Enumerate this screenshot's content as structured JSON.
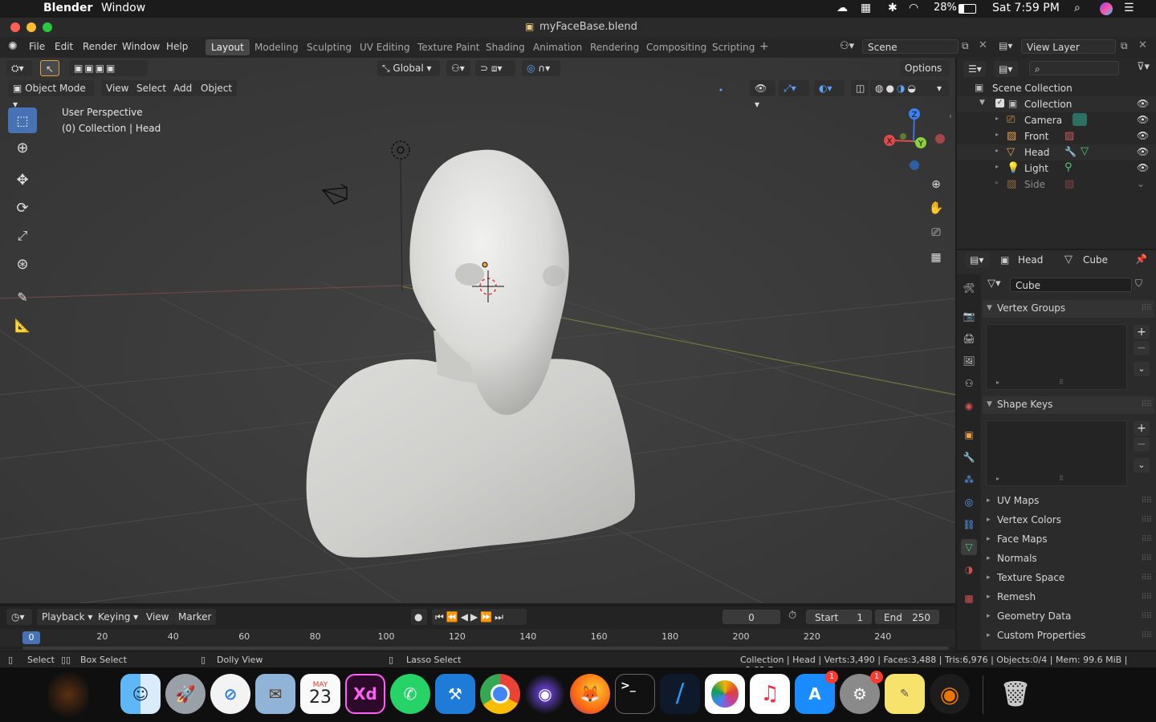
{
  "macos": {
    "app_name": "Blender",
    "menus": [
      "Window"
    ],
    "battery": "28%",
    "clock": "Sat 7:59 PM"
  },
  "window": {
    "title": "myFaceBase.blend"
  },
  "topbar": {
    "menus": [
      "File",
      "Edit",
      "Render",
      "Window",
      "Help"
    ],
    "workspaces": [
      "Layout",
      "Modeling",
      "Sculpting",
      "UV Editing",
      "Texture Paint",
      "Shading",
      "Animation",
      "Rendering",
      "Compositing",
      "Scripting"
    ],
    "active_workspace": "Layout",
    "scene": "Scene",
    "view_layer": "View Layer"
  },
  "viewport": {
    "mode": "Object Mode",
    "menus": [
      "View",
      "Select",
      "Add",
      "Object"
    ],
    "transform_orientation": "Global",
    "options_label": "Options",
    "overlay_title": "User Perspective",
    "overlay_subtitle": "(0) Collection | Head",
    "gizmo_axes": [
      "X",
      "Y",
      "Z"
    ]
  },
  "outliner": {
    "root": "Scene Collection",
    "collection": "Collection",
    "items": [
      {
        "name": "Camera",
        "icon": "camera-icon"
      },
      {
        "name": "Front",
        "icon": "image-empty-icon"
      },
      {
        "name": "Head",
        "icon": "mesh-icon"
      },
      {
        "name": "Light",
        "icon": "light-icon"
      },
      {
        "name": "Side",
        "icon": "image-empty-icon"
      }
    ]
  },
  "properties": {
    "object": "Head",
    "data": "Cube",
    "mesh_name": "Cube",
    "vertex_groups": "Vertex Groups",
    "shape_keys": "Shape Keys",
    "collapsed_panels": [
      "UV Maps",
      "Vertex Colors",
      "Face Maps",
      "Normals",
      "Texture Space",
      "Remesh",
      "Geometry Data",
      "Custom Properties"
    ]
  },
  "timeline": {
    "menus": [
      "Playback",
      "Keying",
      "View",
      "Marker"
    ],
    "current_frame": "0",
    "start_label": "Start",
    "start": "1",
    "end_label": "End",
    "end": "250",
    "ruler": [
      "0",
      "20",
      "40",
      "60",
      "80",
      "100",
      "120",
      "140",
      "160",
      "180",
      "200",
      "220",
      "240"
    ]
  },
  "statusbar": {
    "select": "Select",
    "box_select": "Box Select",
    "dolly_view": "Dolly View",
    "lasso_select": "Lasso Select",
    "stats": "Collection | Head | Verts:3,490 | Faces:3,488 | Tris:6,976 | Objects:0/4 | Mem: 99.6 MiB | v2.82.7"
  },
  "dock": {
    "calendar_month": "MAY",
    "calendar_day": "23",
    "xd_label": "Xd",
    "badges": {
      "appstore": "1",
      "settings": "1"
    }
  },
  "colors": {
    "accent_blue": "#4772b3",
    "viewport_bg": "#393939",
    "panel_bg": "#2b2b2b"
  }
}
